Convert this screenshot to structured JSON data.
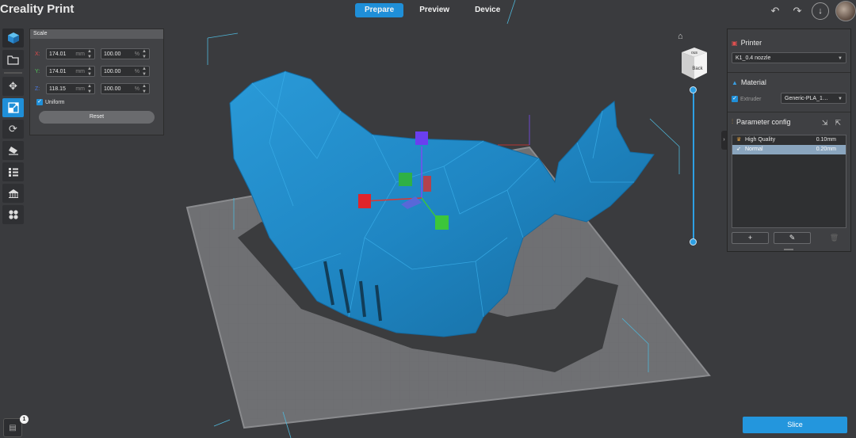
{
  "app": {
    "title": "Creality Print"
  },
  "top_tabs": [
    {
      "label": "Prepare",
      "active": true
    },
    {
      "label": "Preview",
      "active": false
    },
    {
      "label": "Device",
      "active": false
    }
  ],
  "top_right": {
    "undo_icon": "undo-icon",
    "redo_icon": "redo-icon",
    "download_icon": "download-icon"
  },
  "left_toolbar": [
    {
      "name": "add-model",
      "icon": "cube-icon",
      "active": false
    },
    {
      "name": "open-file",
      "icon": "folder-icon",
      "active": false
    },
    {
      "name": "move",
      "icon": "move-icon",
      "active": false
    },
    {
      "name": "scale",
      "icon": "scale-icon",
      "active": true
    },
    {
      "name": "rotate",
      "icon": "rotate-icon",
      "active": false
    },
    {
      "name": "lay-flat",
      "icon": "lay-flat-icon",
      "active": false
    },
    {
      "name": "split",
      "icon": "split-icon",
      "active": false
    },
    {
      "name": "support",
      "icon": "support-icon",
      "active": false
    },
    {
      "name": "arrange",
      "icon": "arrange-icon",
      "active": false
    }
  ],
  "scale_panel": {
    "title": "Scale",
    "rows": [
      {
        "axis": "X:",
        "mm": "174.01",
        "mm_unit": "mm",
        "pct": "100.00",
        "pct_unit": "%"
      },
      {
        "axis": "Y:",
        "mm": "174.01",
        "mm_unit": "mm",
        "pct": "100.00",
        "pct_unit": "%"
      },
      {
        "axis": "Z:",
        "mm": "118.15",
        "mm_unit": "mm",
        "pct": "100.00",
        "pct_unit": "%"
      }
    ],
    "uniform_label": "Uniform",
    "uniform_checked": true,
    "reset_label": "Reset"
  },
  "view_cube": {
    "top_label": "ous",
    "front_label": "Back"
  },
  "right_panel": {
    "printer_title": "Printer",
    "printer_value": "K1_0.4 nozzle",
    "material_title": "Material",
    "extruder_label": "Extruder",
    "extruder_value": "Generic-PLA_1…",
    "param_title": "Parameter config",
    "param_items": [
      {
        "label": "High Quality",
        "value": "0.10mm",
        "selected": false
      },
      {
        "label": "Normal",
        "value": "0.20mm",
        "selected": true
      }
    ],
    "add_label": "+",
    "edit_icon": "edit-icon",
    "delete_icon": "trash-icon"
  },
  "bottom": {
    "slice_label": "Slice",
    "badge_count": "1"
  },
  "colors": {
    "accent": "#1f8fd8",
    "model": "#1f86c3",
    "background": "#3a3b3e"
  }
}
